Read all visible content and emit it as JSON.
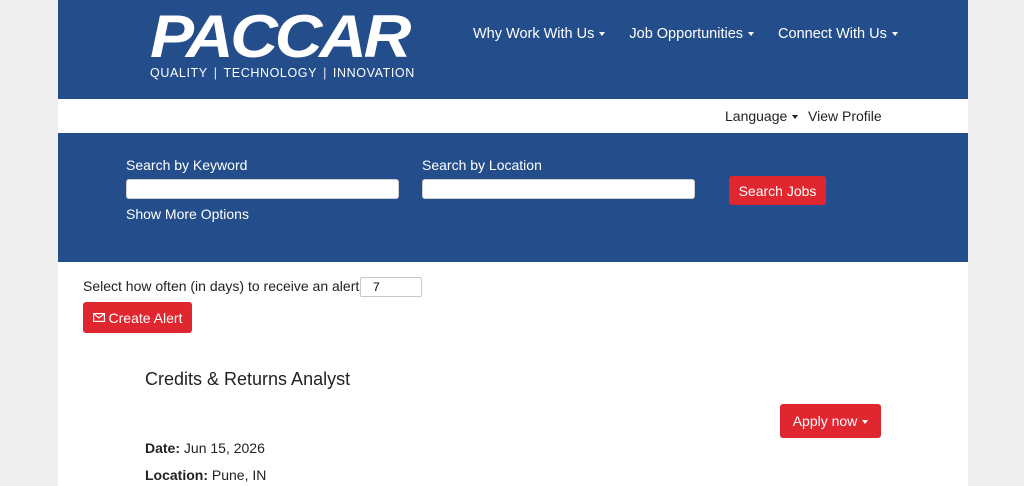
{
  "header": {
    "brand": "PACCAR",
    "tagline": [
      "QUALITY",
      "TECHNOLOGY",
      "INNOVATION"
    ],
    "nav": [
      {
        "label": "Why Work With Us"
      },
      {
        "label": "Job Opportunities"
      },
      {
        "label": "Connect With Us"
      }
    ]
  },
  "utility": {
    "language_label": "Language",
    "profile_label": "View Profile"
  },
  "search": {
    "keyword_label": "Search by Keyword",
    "keyword_value": "",
    "location_label": "Search by Location",
    "location_value": "",
    "button_label": "Search Jobs",
    "more_options": "Show More Options"
  },
  "alert": {
    "label": "Select how often (in days) to receive an alert:",
    "days_value": "7",
    "button_label": "Create Alert"
  },
  "job": {
    "title": "Credits & Returns Analyst",
    "apply_label": "Apply now",
    "date_label": "Date:",
    "date_value": "Jun 15, 2026",
    "location_label": "Location:",
    "location_value": "Pune, IN"
  },
  "colors": {
    "brand_blue": "#234d8b",
    "accent_red": "#e0262f",
    "page_bg": "#efefef"
  },
  "icons": {
    "create_alert": "envelope-icon",
    "dropdown": "caret-down-icon"
  }
}
